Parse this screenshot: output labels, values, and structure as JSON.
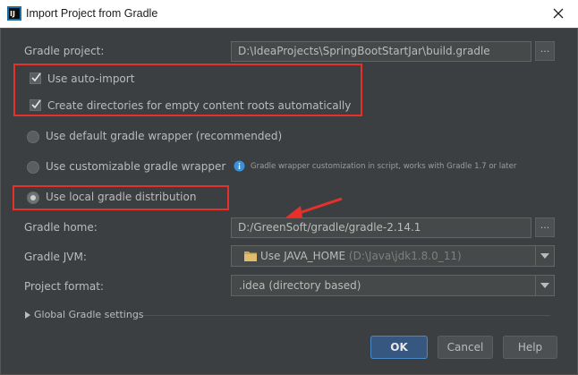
{
  "window": {
    "title": "Import Project from Gradle"
  },
  "gradle_project": {
    "label": "Gradle project:",
    "value": "D:\\IdeaProjects\\SpringBootStartJar\\build.gradle",
    "browse": "..."
  },
  "options": {
    "auto_import": {
      "label": "Use auto-import",
      "checked": true
    },
    "create_dirs": {
      "label": "Create directories for empty content roots automatically",
      "checked": true
    }
  },
  "distribution": {
    "default_wrapper": "Use default gradle wrapper (recommended)",
    "custom_wrapper": "Use customizable gradle wrapper",
    "custom_hint": "Gradle wrapper customization in script, works with Gradle 1.7 or later",
    "local": "Use local gradle distribution",
    "selected": "local"
  },
  "gradle_home": {
    "label": "Gradle home:",
    "value": "D:/GreenSoft/gradle/gradle-2.14.1",
    "browse": "..."
  },
  "gradle_jvm": {
    "label": "Gradle JVM:",
    "value": "Use JAVA_HOME",
    "detail": "(D:\\Java\\jdk1.8.0_11)"
  },
  "project_format": {
    "label": "Project format:",
    "value": ".idea (directory based)"
  },
  "global_settings": {
    "label": "Global Gradle settings"
  },
  "buttons": {
    "ok": "OK",
    "cancel": "Cancel",
    "help": "Help"
  },
  "colors": {
    "background": "#3c3f41",
    "annotation": "#e8302a",
    "default_button": "#365880"
  }
}
